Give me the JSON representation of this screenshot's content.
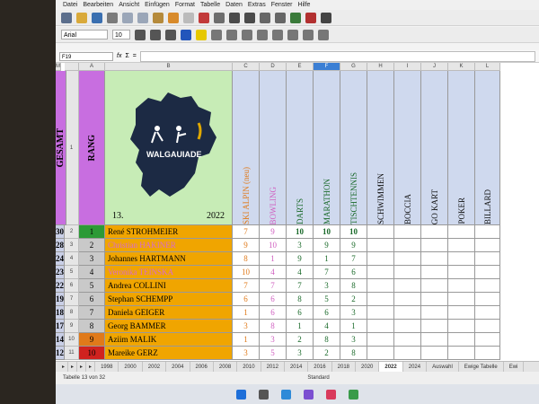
{
  "menu": [
    "Datei",
    "Bearbeiten",
    "Ansicht",
    "Einfügen",
    "Format",
    "Tabelle",
    "Daten",
    "Extras",
    "Fenster",
    "Hilfe"
  ],
  "toolbar": {
    "font_name": "Arial",
    "font_size": "10"
  },
  "formula": {
    "cell_ref": "F19",
    "fx": "fx",
    "sum": "Σ",
    "eq": "="
  },
  "columns": [
    "A",
    "B",
    "C",
    "D",
    "E",
    "F",
    "G",
    "H",
    "I",
    "J",
    "K",
    "L",
    "M"
  ],
  "header_row": {
    "row_label": "1",
    "rang": "RANG",
    "logo_text": "WALGAUIADE",
    "logo_number": "13.",
    "logo_year": "2022",
    "disciplines": [
      "SKI ALPIN (neu)",
      "BOWLING",
      "DARTS",
      "MARATHON",
      "TISCHTENNIS",
      "SCHWIMMEN",
      "BOCCIA",
      "GO KART",
      "POKER",
      "BILLARD"
    ],
    "gesamt": "GESAMT"
  },
  "rows": [
    {
      "row": "2",
      "rank": "1",
      "name": "René STROHMEIER",
      "scores": [
        "7",
        "9",
        "10",
        "10",
        "10",
        "",
        "",
        "",
        "",
        ""
      ],
      "total": "30"
    },
    {
      "row": "3",
      "rank": "2",
      "name": "Christian HAKINER",
      "scores": [
        "9",
        "10",
        "3",
        "9",
        "9",
        "",
        "",
        "",
        "",
        ""
      ],
      "total": "28"
    },
    {
      "row": "4",
      "rank": "3",
      "name": "Johannes HARTMANN",
      "scores": [
        "8",
        "1",
        "9",
        "1",
        "7",
        "",
        "",
        "",
        "",
        ""
      ],
      "total": "24"
    },
    {
      "row": "5",
      "rank": "4",
      "name": "Veronika TEINSKA",
      "scores": [
        "10",
        "4",
        "4",
        "7",
        "6",
        "",
        "",
        "",
        "",
        ""
      ],
      "total": "23"
    },
    {
      "row": "6",
      "rank": "5",
      "name": "Andrea COLLINI",
      "scores": [
        "7",
        "7",
        "7",
        "3",
        "8",
        "",
        "",
        "",
        "",
        ""
      ],
      "total": "22"
    },
    {
      "row": "7",
      "rank": "6",
      "name": "Stephan SCHEMPP",
      "scores": [
        "6",
        "6",
        "8",
        "5",
        "2",
        "",
        "",
        "",
        "",
        ""
      ],
      "total": "19"
    },
    {
      "row": "8",
      "rank": "7",
      "name": "Daniela GEIGER",
      "scores": [
        "1",
        "6",
        "6",
        "6",
        "3",
        "",
        "",
        "",
        "",
        ""
      ],
      "total": "18"
    },
    {
      "row": "9",
      "rank": "8",
      "name": "Georg BAMMER",
      "scores": [
        "3",
        "8",
        "1",
        "4",
        "1",
        "",
        "",
        "",
        "",
        ""
      ],
      "total": "17"
    },
    {
      "row": "10",
      "rank": "9",
      "name": "Aziim MALIK",
      "scores": [
        "1",
        "3",
        "2",
        "8",
        "3",
        "",
        "",
        "",
        "",
        ""
      ],
      "total": "14"
    },
    {
      "row": "11",
      "rank": "10",
      "name": "Mareike GERZ",
      "scores": [
        "3",
        "5",
        "3",
        "2",
        "8",
        "",
        "",
        "",
        "",
        ""
      ],
      "total": "12"
    }
  ],
  "sheet_tabs": [
    "1998",
    "2000",
    "2002",
    "2004",
    "2006",
    "2008",
    "2010",
    "2012",
    "2014",
    "2016",
    "2018",
    "2020",
    "2022",
    "2024",
    "Auswahl",
    "Ewige Tabelle",
    "Ewi"
  ],
  "active_tab": "2022",
  "status": {
    "sheet": "Tabelle 13 von 32",
    "style": "Standard"
  },
  "colors": {
    "rang_col": "#c86ee0",
    "gesamt_col": "#c86ee0",
    "name_fill": "#f0a500",
    "rank_green": "#2c9a36",
    "rank_orange": "#e07a1a",
    "rank_red": "#d0221f",
    "rank_grey": "#c9c9c9",
    "header_blue": "#cfd9ee",
    "logo_bg": "#c7ecb6",
    "total_bg": "#c9cfe6"
  }
}
